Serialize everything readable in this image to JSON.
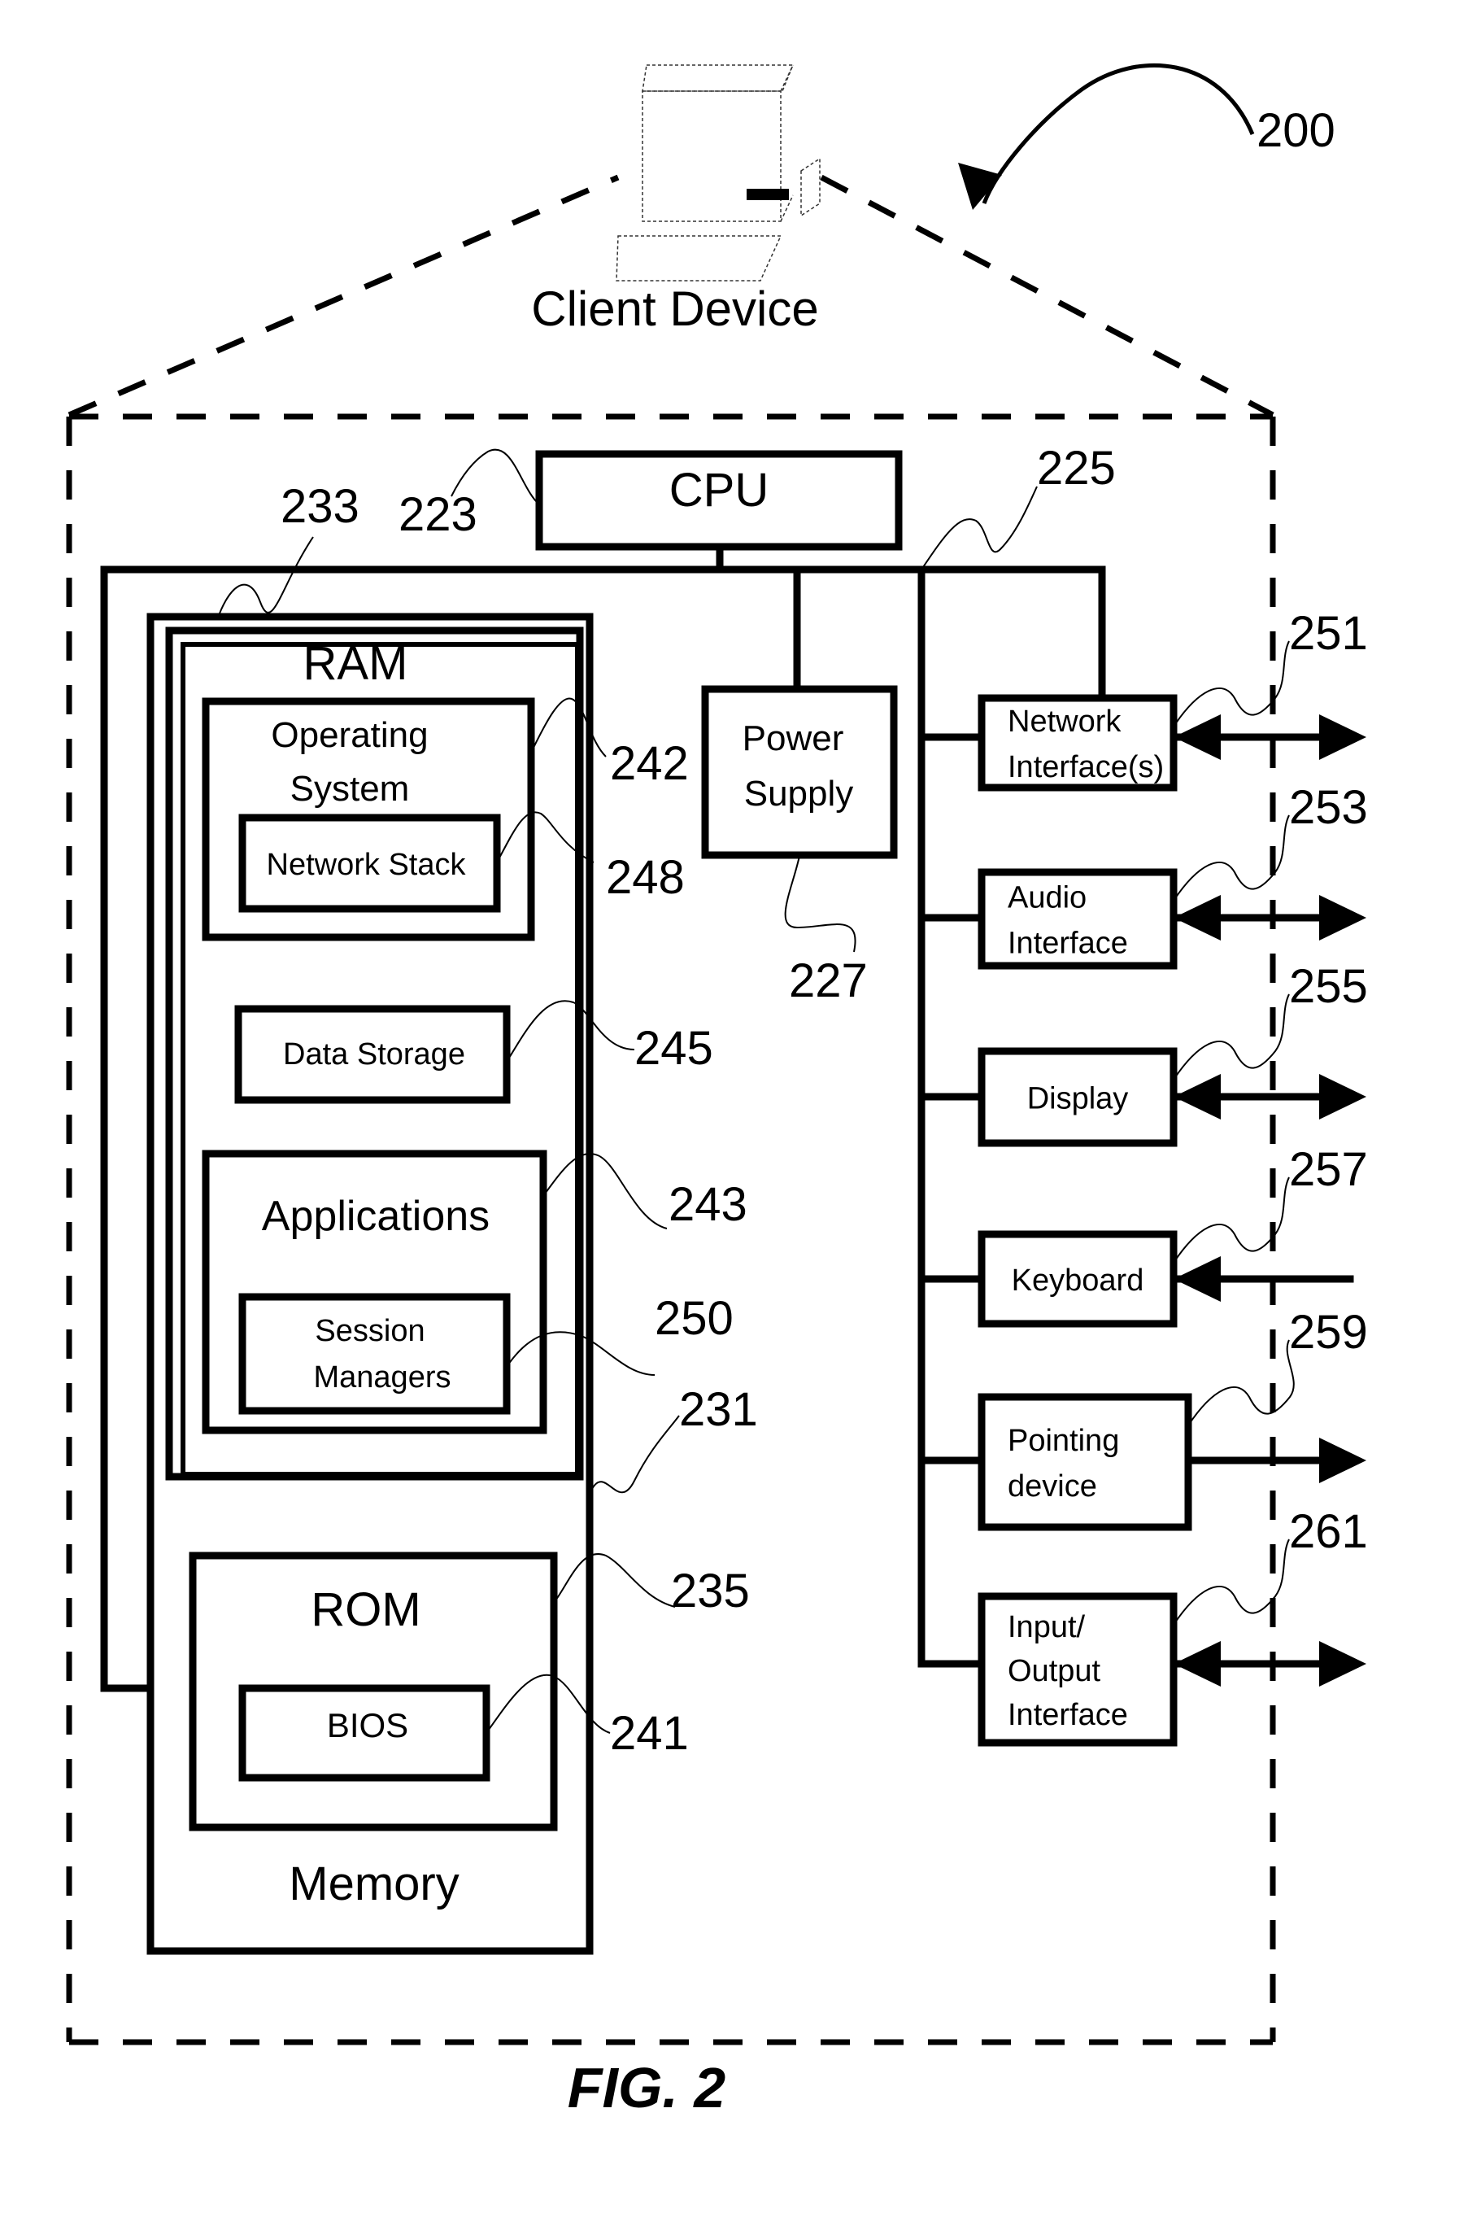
{
  "figure": {
    "caption": "FIG. 2",
    "title": "Client Device",
    "reference": "200"
  },
  "components": {
    "cpu": {
      "label": "CPU",
      "ref": "223"
    },
    "bus": {
      "ref": "225"
    },
    "power_supply": {
      "line1": "Power",
      "line2": "Supply",
      "ref": "227"
    },
    "memory": {
      "label": "Memory",
      "ref": "231"
    },
    "ram": {
      "label": "RAM",
      "ref": "233"
    },
    "os": {
      "line1": "Operating",
      "line2": "System",
      "ref": "242"
    },
    "network_stack": {
      "label": "Network Stack",
      "ref": "248"
    },
    "data_storage": {
      "label": "Data Storage",
      "ref": "245"
    },
    "applications": {
      "label": "Applications",
      "ref": "243"
    },
    "session_managers": {
      "line1": "Session",
      "line2": "Managers",
      "ref": "250"
    },
    "rom": {
      "label": "ROM",
      "ref": "235"
    },
    "bios": {
      "label": "BIOS",
      "ref": "241"
    }
  },
  "peripherals": [
    {
      "id": "network-interface",
      "lines": [
        "Network",
        "Interface(s)"
      ],
      "ref": "251",
      "direction": "bidirectional"
    },
    {
      "id": "audio-interface",
      "lines": [
        "Audio",
        "Interface"
      ],
      "ref": "253",
      "direction": "bidirectional"
    },
    {
      "id": "display",
      "lines": [
        "Display"
      ],
      "ref": "255",
      "direction": "bidirectional"
    },
    {
      "id": "keyboard",
      "lines": [
        "Keyboard"
      ],
      "ref": "257",
      "direction": "input"
    },
    {
      "id": "pointing-device",
      "lines": [
        "Pointing",
        "device"
      ],
      "ref": "259",
      "direction": "output"
    },
    {
      "id": "io-interface",
      "lines": [
        "Input/",
        "Output",
        "Interface"
      ],
      "ref": "261",
      "direction": "bidirectional"
    }
  ]
}
